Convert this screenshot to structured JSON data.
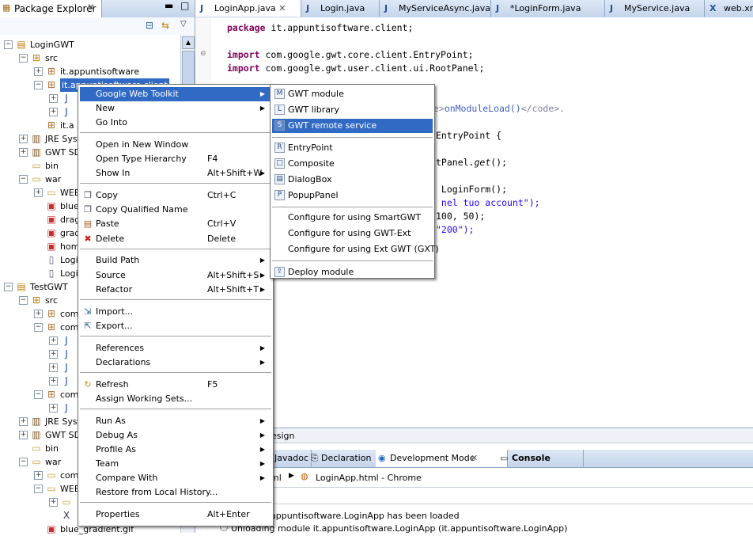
{
  "package_explorer": {
    "title": "Package Explorer",
    "tree": [
      {
        "label": "LoginGWT",
        "exp": "-",
        "icon": "project-icon"
      },
      {
        "label": "src",
        "exp": "-",
        "icon": "source-folder-icon"
      },
      {
        "label": "it.appuntisoftware",
        "exp": "+",
        "icon": "package-icon"
      },
      {
        "label": "it.appuntisoftware.client",
        "exp": "-",
        "icon": "package-icon"
      },
      {
        "label": "",
        "exp": "+",
        "icon": "java-file-icon"
      },
      {
        "label": "",
        "exp": "+",
        "icon": "java-file-icon"
      },
      {
        "label": "it.a",
        "exp": "",
        "icon": "package-icon"
      },
      {
        "label": "JRE System Library",
        "exp": "+",
        "icon": "library-icon"
      },
      {
        "label": "GWT SDK",
        "exp": "+",
        "icon": "library-icon"
      },
      {
        "label": "bin",
        "exp": "",
        "icon": "folder-icon"
      },
      {
        "label": "war",
        "exp": "-",
        "icon": "folder-icon"
      },
      {
        "label": "WEB-INF",
        "exp": "+",
        "icon": "folder-icon"
      },
      {
        "label": "blue_gradient.gif",
        "exp": "",
        "icon": "image-icon"
      },
      {
        "label": "drag.gif",
        "exp": "",
        "icon": "image-icon"
      },
      {
        "label": "gradient.gif",
        "exp": "",
        "icon": "image-icon"
      },
      {
        "label": "home.gif",
        "exp": "",
        "icon": "image-icon"
      },
      {
        "label": "LoginApp.css",
        "exp": "",
        "icon": "file-icon"
      },
      {
        "label": "LoginApp.html",
        "exp": "",
        "icon": "file-icon"
      },
      {
        "label": "TestGWT",
        "exp": "-",
        "icon": "project-icon"
      },
      {
        "label": "src",
        "exp": "-",
        "icon": "source-folder-icon"
      },
      {
        "label": "com",
        "exp": "+",
        "icon": "package-icon"
      },
      {
        "label": "com",
        "exp": "-",
        "icon": "package-icon"
      },
      {
        "label": "",
        "exp": "+",
        "icon": "java-file-icon"
      },
      {
        "label": "",
        "exp": "+",
        "icon": "java-file-icon"
      },
      {
        "label": "",
        "exp": "+",
        "icon": "java-file-icon"
      },
      {
        "label": "",
        "exp": "+",
        "icon": "java-file-icon"
      },
      {
        "label": "com",
        "exp": "-",
        "icon": "package-icon"
      },
      {
        "label": "",
        "exp": "+",
        "icon": "java-file-icon"
      },
      {
        "label": "JRE System Library",
        "exp": "+",
        "icon": "library-icon"
      },
      {
        "label": "GWT SDK",
        "exp": "+",
        "icon": "library-icon"
      },
      {
        "label": "bin",
        "exp": "",
        "icon": "folder-icon"
      },
      {
        "label": "war",
        "exp": "-",
        "icon": "folder-icon"
      },
      {
        "label": "com",
        "exp": "+",
        "icon": "folder-icon"
      },
      {
        "label": "WEB-INF",
        "exp": "-",
        "icon": "folder-icon"
      },
      {
        "label": "",
        "exp": "+",
        "icon": "folder-icon"
      },
      {
        "label": "",
        "exp": "",
        "icon": "xml-file-icon"
      },
      {
        "label": "blue_gradient.gif",
        "exp": "",
        "icon": "image-icon"
      }
    ]
  },
  "editor": {
    "tabs": [
      {
        "label": "LoginApp.java",
        "active": true
      },
      {
        "label": "Login.java"
      },
      {
        "label": "MyServiceAsync.java"
      },
      {
        "label": "*LoginForm.java"
      },
      {
        "label": "MyService.java"
      },
      {
        "label": "web.xml"
      }
    ],
    "code": {
      "l1_kw": "package",
      "l1_rest": " it.appuntisoftware.client;",
      "l2_kw": "import",
      "l2_rest": " com.google.gwt.core.client.EntryPoint;",
      "l3_kw": "import",
      "l3_rest": " com.google.gwt.user.client.ui.RootPanel;",
      "l4_tag1": "de>",
      "l4_text": "onModuleLoad()",
      "l4_tag2": "</code>.",
      "l5": "EntryPoint {",
      "l6_a": "tPanel.",
      "l6_b": "get",
      "l6_c": "();",
      "l7": " LoginForm();",
      "l8": " nel tuo account\");",
      "l9": "100, 50);",
      "l10": "\"200\");"
    }
  },
  "bottom_panel": {
    "design_tab": "esign",
    "tabs": [
      "Javadoc",
      "Declaration",
      "Development Mode",
      "Console"
    ],
    "breadcrumb_1": "ml",
    "breadcrumb_2": "LoginApp.html - Chrome",
    "log_1": "appuntisoftware.LoginApp has been loaded",
    "log_2": "Unloading module it.appuntisoftware.LoginApp (it.appuntisoftware.LoginApp)"
  },
  "context_menu": {
    "items": [
      {
        "label": "Google Web Toolkit",
        "submenu": true,
        "selected": true
      },
      {
        "label": "New",
        "submenu": true
      },
      {
        "label": "Go Into"
      },
      {
        "sep": true
      },
      {
        "label": "Open in New Window"
      },
      {
        "label": "Open Type Hierarchy",
        "key": "F4"
      },
      {
        "label": "Show In",
        "key": "Alt+Shift+W",
        "submenu": true
      },
      {
        "sep": true
      },
      {
        "label": "Copy",
        "key": "Ctrl+C",
        "icon": "copy-icon"
      },
      {
        "label": "Copy Qualified Name",
        "icon": "copy-icon"
      },
      {
        "label": "Paste",
        "key": "Ctrl+V",
        "icon": "paste-icon"
      },
      {
        "label": "Delete",
        "key": "Delete",
        "icon": "delete-icon"
      },
      {
        "sep": true
      },
      {
        "label": "Build Path",
        "submenu": true
      },
      {
        "label": "Source",
        "key": "Alt+Shift+S",
        "submenu": true
      },
      {
        "label": "Refactor",
        "key": "Alt+Shift+T",
        "submenu": true
      },
      {
        "sep": true
      },
      {
        "label": "Import...",
        "icon": "import-icon"
      },
      {
        "label": "Export...",
        "icon": "export-icon"
      },
      {
        "sep": true
      },
      {
        "label": "References",
        "submenu": true
      },
      {
        "label": "Declarations",
        "submenu": true
      },
      {
        "sep": true
      },
      {
        "label": "Refresh",
        "key": "F5",
        "icon": "refresh-icon"
      },
      {
        "label": "Assign Working Sets..."
      },
      {
        "sep": true
      },
      {
        "label": "Run As",
        "submenu": true
      },
      {
        "label": "Debug As",
        "submenu": true
      },
      {
        "label": "Profile As",
        "submenu": true
      },
      {
        "label": "Team",
        "submenu": true
      },
      {
        "label": "Compare With",
        "submenu": true
      },
      {
        "label": "Restore from Local History..."
      },
      {
        "sep": true
      },
      {
        "label": "Properties",
        "key": "Alt+Enter"
      }
    ]
  },
  "gwt_submenu": {
    "items": [
      {
        "label": "GWT module",
        "icon": "gwt-module-icon"
      },
      {
        "label": "GWT library",
        "icon": "gwt-library-icon"
      },
      {
        "label": "GWT remote service",
        "icon": "gwt-service-icon",
        "selected": true
      },
      {
        "sep": true
      },
      {
        "label": "EntryPoint",
        "icon": "entrypoint-icon"
      },
      {
        "label": "Composite",
        "icon": "composite-icon"
      },
      {
        "label": "DialogBox",
        "icon": "dialogbox-icon"
      },
      {
        "label": "PopupPanel",
        "icon": "popuppanel-icon"
      },
      {
        "sep": true
      },
      {
        "label": "Configure for using SmartGWT"
      },
      {
        "label": "Configure for using GWT-Ext"
      },
      {
        "label": "Configure for using Ext GWT (GXT)"
      },
      {
        "sep": true
      },
      {
        "label": "Deploy module",
        "icon": "deploy-icon"
      }
    ]
  },
  "colors": {
    "selection": "#316ac5",
    "keyword": "#7f0055",
    "string": "#2a00ff"
  }
}
